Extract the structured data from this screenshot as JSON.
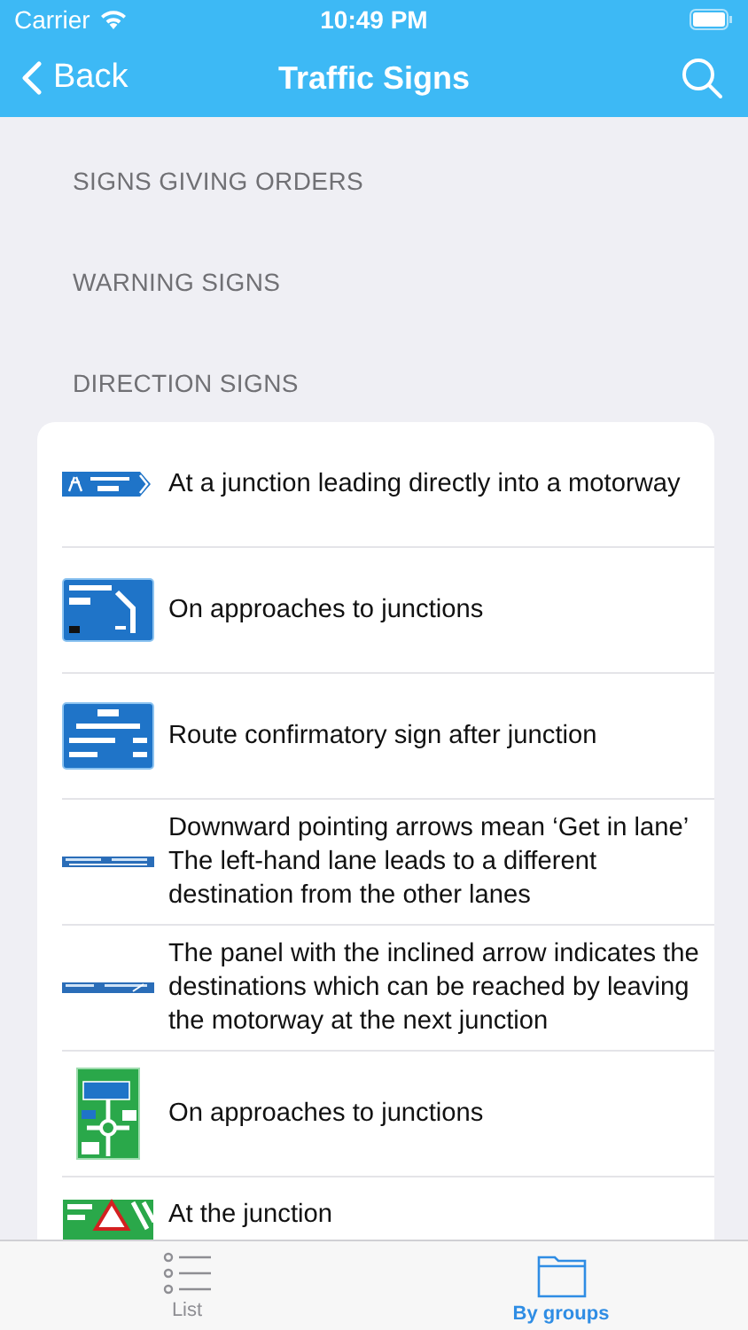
{
  "status_bar": {
    "carrier": "Carrier",
    "time": "10:49 PM"
  },
  "nav": {
    "back": "Back",
    "title": "Traffic Signs"
  },
  "groups": [
    {
      "title": "SIGNS GIVING ORDERS"
    },
    {
      "title": "WARNING SIGNS"
    },
    {
      "title": "DIRECTION SIGNS"
    }
  ],
  "signs": [
    {
      "kind": "motorway",
      "text": "At a junction leading directly into a motorway"
    },
    {
      "kind": "approach",
      "text": "On approaches to junctions"
    },
    {
      "kind": "route",
      "text": "Route confirmatory sign after junction"
    },
    {
      "kind": "lane-strip",
      "text": "Downward pointing arrows mean ‘Get in lane’ The left-hand lane leads to a different destination from the other lanes"
    },
    {
      "kind": "panel-strip",
      "text": "The panel with the inclined arrow indicates the destinations which can be reached by leaving the motorway at the next junction"
    },
    {
      "kind": "roundabout",
      "text": "On approaches to junctions"
    },
    {
      "kind": "warning",
      "text": "At the junction"
    }
  ],
  "tabs": [
    {
      "label": "List",
      "kind": "list",
      "selected": false
    },
    {
      "label": "By groups",
      "kind": "folder",
      "selected": true
    }
  ]
}
